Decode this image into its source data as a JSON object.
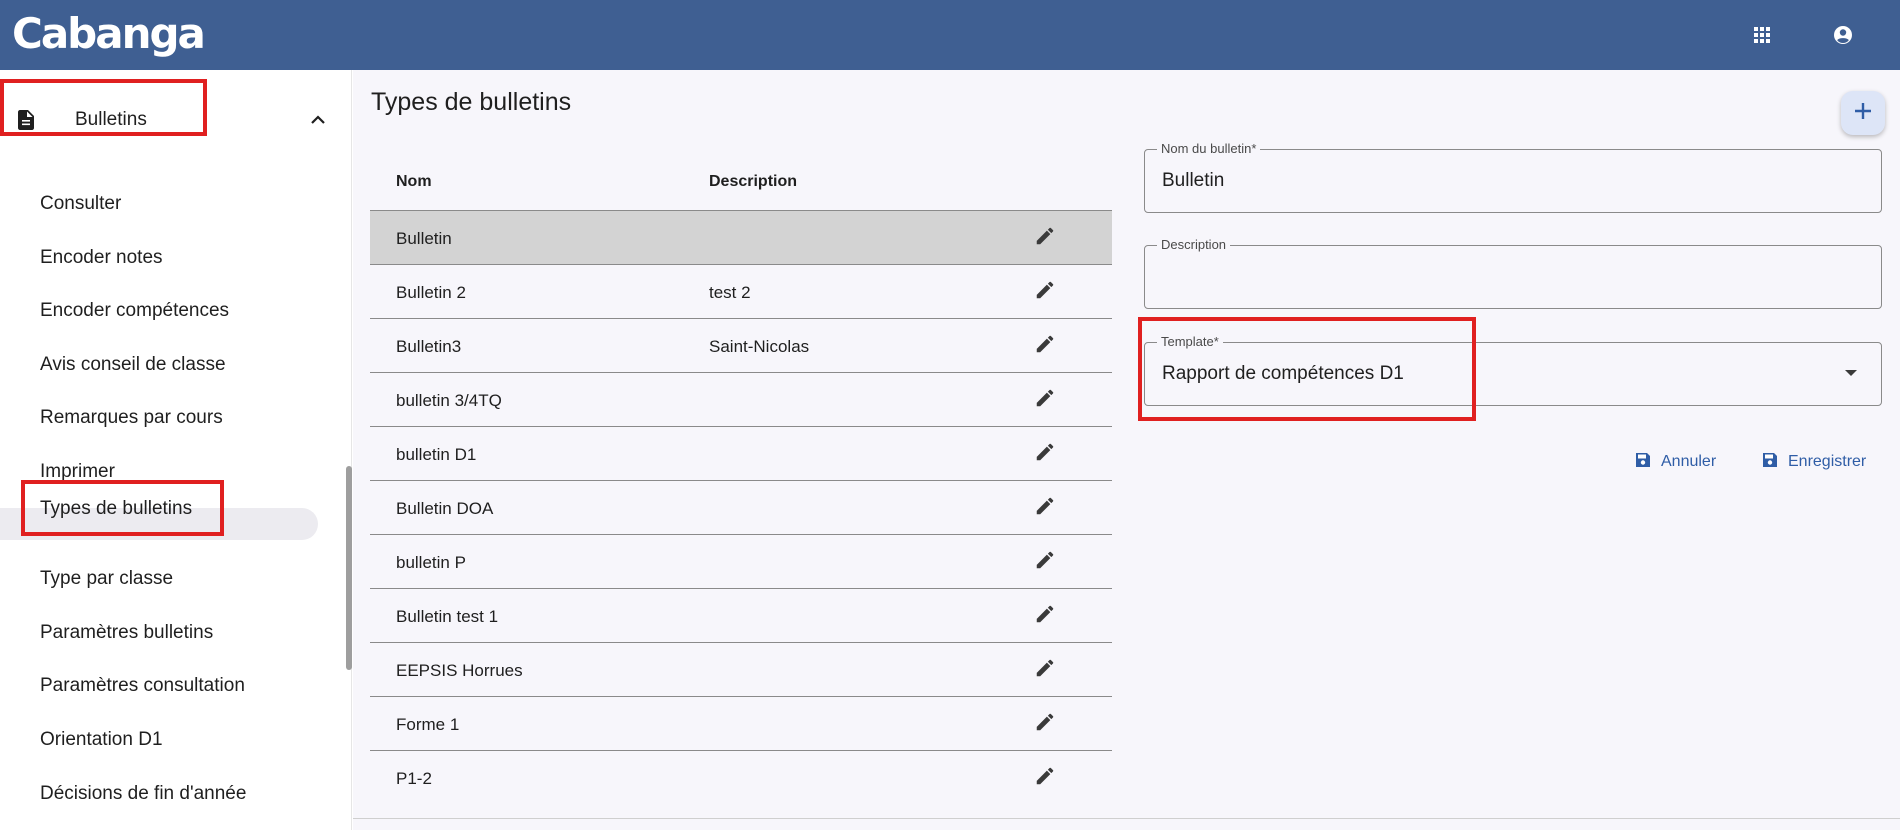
{
  "app": {
    "logo_text": "Cabanga"
  },
  "topbar": {
    "icons": [
      "apps-grid-icon",
      "account-circle-icon"
    ],
    "color": "#3f5f92"
  },
  "sidebar": {
    "group": {
      "label": "Bulletins",
      "icon": "document-icon",
      "expanded": true
    },
    "items": [
      {
        "label": "Consulter"
      },
      {
        "label": "Encoder notes"
      },
      {
        "label": "Encoder compétences"
      },
      {
        "label": "Avis conseil de classe"
      },
      {
        "label": "Remarques par cours"
      },
      {
        "label": "Imprimer"
      },
      {
        "label": "Types de bulletins",
        "active": true
      },
      {
        "label": "Type par classe"
      },
      {
        "label": "Paramètres bulletins"
      },
      {
        "label": "Paramètres consultation"
      },
      {
        "label": "Orientation D1"
      },
      {
        "label": "Décisions de fin d'année"
      }
    ]
  },
  "main": {
    "title": "Types de bulletins",
    "fab_icon": "plus-icon",
    "table": {
      "headers": {
        "name": "Nom",
        "description": "Description"
      },
      "rows": [
        {
          "name": "Bulletin",
          "description": "",
          "selected": true
        },
        {
          "name": "Bulletin 2",
          "description": "test 2"
        },
        {
          "name": "Bulletin3",
          "description": "Saint-Nicolas"
        },
        {
          "name": "bulletin 3/4TQ",
          "description": ""
        },
        {
          "name": "bulletin D1",
          "description": ""
        },
        {
          "name": "Bulletin DOA",
          "description": ""
        },
        {
          "name": "bulletin P",
          "description": ""
        },
        {
          "name": "Bulletin test 1",
          "description": ""
        },
        {
          "name": "EEPSIS Horrues",
          "description": ""
        },
        {
          "name": "Forme 1",
          "description": ""
        },
        {
          "name": "P1-2",
          "description": ""
        }
      ]
    },
    "form": {
      "name_label": "Nom du bulletin*",
      "name_value": "Bulletin",
      "description_label": "Description",
      "description_value": "",
      "template_label": "Template*",
      "template_value": "Rapport de compétences D1",
      "cancel_label": "Annuler",
      "save_label": "Enregistrer"
    }
  },
  "colors": {
    "accent": "#2f5da6",
    "highlight": "#e02020",
    "selected_row": "#d3d3d3"
  }
}
